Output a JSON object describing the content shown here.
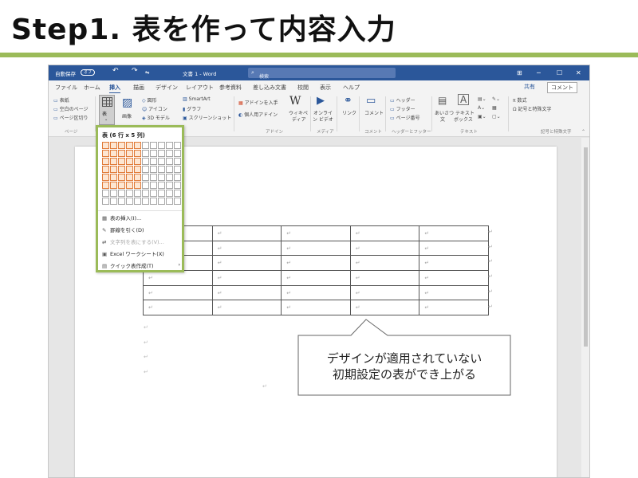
{
  "slide": {
    "title": "Step1. 表を作って内容入力",
    "callout_line1": "デザインが適用されていない",
    "callout_line2": "初期設定の表ができ上がる",
    "accent_color": "#9bbb59"
  },
  "titlebar": {
    "autosave": "自動保存",
    "autosave_toggle": "オフ",
    "undo": "↶",
    "redo": "↷",
    "more": "⇋",
    "doc_title": "文書 1  -  Word",
    "search_icon": "⌕",
    "search_placeholder": "検索",
    "ribbon_display_icon": "⊞",
    "minimize_icon": "─",
    "maximize_icon": "☐",
    "close_icon": "✕",
    "color": "#2b579a"
  },
  "tabs": [
    "ファイル",
    "ホーム",
    "挿入",
    "描画",
    "デザイン",
    "レイアウト",
    "参考資料",
    "差し込み文書",
    "校閲",
    "表示",
    "ヘルプ"
  ],
  "active_tab": "挿入",
  "share_label": "共有",
  "comment_label": "コメント",
  "ribbon": {
    "pages": {
      "cover": "表紙",
      "blank": "空白のページ",
      "break": "ページ区切り",
      "label": "ページ"
    },
    "table": {
      "label": "表",
      "caret": "⌄"
    },
    "images": {
      "label": "画像",
      "shapes": "図形",
      "icons": "アイコン",
      "model3d": "3D モデル",
      "smartart": "SmartArt",
      "chart": "グラフ",
      "screenshot": "スクリーンショット"
    },
    "addins": {
      "get": "アドインを入手",
      "personal": "個人用アドイン",
      "wiki_line1": "ウィキペ",
      "wiki_line2": "ディア",
      "wiki_glyph": "W",
      "label": "アドイン"
    },
    "media": {
      "video_line1": "オンライ",
      "video_line2": "ン ビデオ",
      "label": "メディア"
    },
    "link": {
      "label": "リンク"
    },
    "comment": {
      "label": "コメント"
    },
    "header_footer": {
      "header": "ヘッダー",
      "footer": "フッター",
      "page_number": "ページ番号",
      "label": "ヘッダーとフッター"
    },
    "text": {
      "greeting_line1": "あいさつ",
      "greeting_line2": "文",
      "textbox_line1": "テキスト",
      "textbox_line2": "ボックス",
      "label": "テキスト"
    },
    "symbols": {
      "equation": "数式",
      "symbol": "記号と特殊文字",
      "label": "記号と特殊文字"
    }
  },
  "dropdown": {
    "header": "表 (6 行 x 5 列)",
    "grid_rows": 8,
    "grid_cols": 10,
    "selected_rows": 6,
    "selected_cols": 5,
    "items": [
      {
        "icon": "▦",
        "label": "表の挿入(I)...",
        "disabled": false
      },
      {
        "icon": "✎",
        "label": "罫線を引く(D)",
        "disabled": false
      },
      {
        "icon": "⇄",
        "label": "文字列を表にする(V)...",
        "disabled": true
      },
      {
        "icon": "▣",
        "label": "Excel ワークシート(X)",
        "disabled": false
      },
      {
        "icon": "▤",
        "label": "クイック表作成(T)",
        "disabled": false,
        "submenu": "›"
      }
    ]
  },
  "document": {
    "table_rows": 6,
    "table_cols": 5,
    "cell_mark": "↵",
    "row_end_mark": "↵",
    "paragraph_marks": [
      "↵",
      "↵",
      "↵",
      "↵"
    ]
  }
}
